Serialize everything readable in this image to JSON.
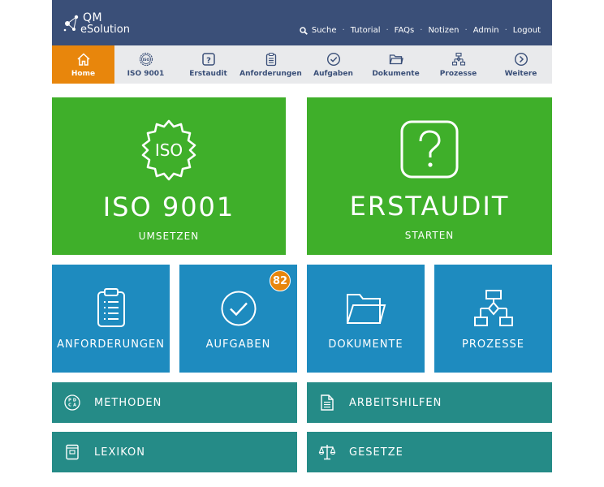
{
  "brand": {
    "line1": "QM",
    "line2": "eSolution"
  },
  "topnav": {
    "search": "Suche",
    "tutorial": "Tutorial",
    "faqs": "FAQs",
    "notizen": "Notizen",
    "admin": "Admin",
    "logout": "Logout",
    "sep": "·"
  },
  "menu": [
    {
      "label": "Home",
      "icon": "home-icon",
      "active": true
    },
    {
      "label": "ISO 9001",
      "icon": "iso-badge-icon"
    },
    {
      "label": "Erstaudit",
      "icon": "question-icon"
    },
    {
      "label": "Anforderungen",
      "icon": "clipboard-icon"
    },
    {
      "label": "Aufgaben",
      "icon": "check-circle-icon"
    },
    {
      "label": "Dokumente",
      "icon": "folder-icon"
    },
    {
      "label": "Prozesse",
      "icon": "flowchart-icon"
    },
    {
      "label": "Weitere",
      "icon": "chevron-right-circle-icon"
    }
  ],
  "tiles": {
    "iso": {
      "icon_text": "ISO",
      "title": "ISO 9001",
      "sub": "UMSETZEN"
    },
    "erstaudit": {
      "title": "ERSTAUDIT",
      "sub": "STARTEN"
    },
    "anforderungen": {
      "title": "ANFORDERUNGEN"
    },
    "aufgaben": {
      "title": "AUFGABEN",
      "badge": "82"
    },
    "dokumente": {
      "title": "DOKUMENTE"
    },
    "prozesse": {
      "title": "PROZESSE"
    },
    "methoden": {
      "title": "METHODEN",
      "icon_text": [
        "P",
        "D",
        "C",
        "A"
      ]
    },
    "arbeitshilfen": {
      "title": "ARBEITSHILFEN"
    },
    "lexikon": {
      "title": "LEXIKON"
    },
    "gesetze": {
      "title": "GESETZE"
    }
  },
  "colors": {
    "header": "#3a4f78",
    "menubar": "#e9eaec",
    "active": "#e8860c",
    "green": "#3faf2a",
    "blue": "#1e8bbf",
    "teal": "#258b87"
  }
}
